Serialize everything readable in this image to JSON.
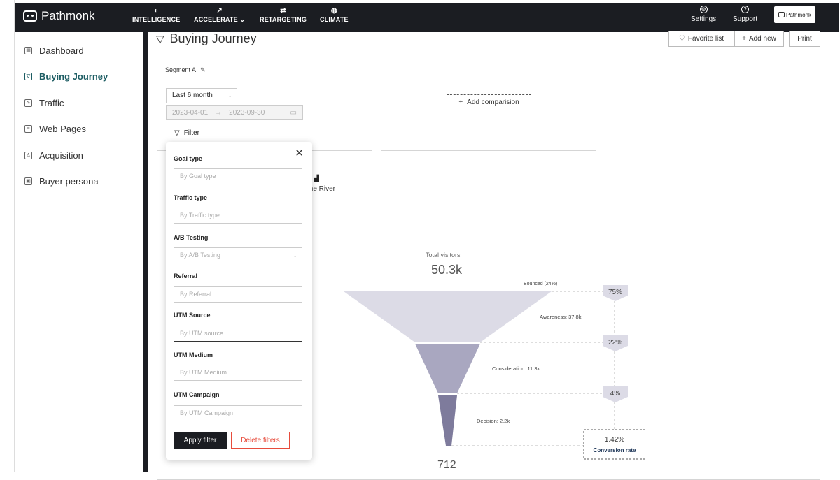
{
  "brand": "Pathmonk",
  "nav": [
    {
      "label": "INTELLIGENCE",
      "icon": "brain-icon"
    },
    {
      "label": "ACCELERATE",
      "icon": "trend-icon"
    },
    {
      "label": "RETARGETING",
      "icon": "retarget-icon"
    },
    {
      "label": "CLIMATE",
      "icon": "globe-icon"
    }
  ],
  "nav_right": [
    {
      "label": "Settings",
      "icon": "gear-icon"
    },
    {
      "label": "Support",
      "icon": "help-icon"
    }
  ],
  "account_label": "Pathmonk",
  "sidebar": [
    {
      "label": "Dashboard",
      "icon": "grid-icon",
      "active": false
    },
    {
      "label": "Buying Journey",
      "icon": "funnel-icon",
      "active": true
    },
    {
      "label": "Traffic",
      "icon": "chart-icon",
      "active": false
    },
    {
      "label": "Web Pages",
      "icon": "page-icon",
      "active": false
    },
    {
      "label": "Acquisition",
      "icon": "trophy-icon",
      "active": false
    },
    {
      "label": "Buyer persona",
      "icon": "persona-icon",
      "active": false
    }
  ],
  "page_title": "Buying Journey",
  "toolbar": {
    "favorite": "Favorite list",
    "add_new": "Add new",
    "print": "Print"
  },
  "segment": {
    "label": "Segment A",
    "period": "Last 6 month",
    "date_from": "2023-04-01",
    "date_to": "2023-09-30",
    "filter_label": "Filter"
  },
  "add_comparison": "Add comparision",
  "river_label": "me River",
  "funnel": {
    "total_label": "Total visitors",
    "total_value": "50.3k",
    "bounced": "Bounced (24%)",
    "stages": [
      "Awareness: 37.8k",
      "Consideration: 11.3k",
      "Decision: 2.2k"
    ],
    "percents": [
      "75%",
      "22%",
      "4%"
    ],
    "conversion_value": "1.42%",
    "conversion_label": "Conversion rate",
    "final_value": "712"
  },
  "filters": [
    {
      "label": "Goal type",
      "placeholder": "By Goal type",
      "dropdown": false
    },
    {
      "label": "Traffic type",
      "placeholder": "By Traffic type",
      "dropdown": false
    },
    {
      "label": "A/B Testing",
      "placeholder": "By A/B Testing",
      "dropdown": true
    },
    {
      "label": "Referral",
      "placeholder": "By Referral",
      "dropdown": false
    },
    {
      "label": "UTM Source",
      "placeholder": "By UTM source",
      "dropdown": false
    },
    {
      "label": "UTM Medium",
      "placeholder": "By UTM Medium",
      "dropdown": false
    },
    {
      "label": "UTM Campaign",
      "placeholder": "By UTM Campaign",
      "dropdown": false
    }
  ],
  "apply_label": "Apply filter",
  "delete_label": "Delete filters",
  "colors": {
    "topbar": "#1b1d22",
    "accent": "#1d5d63",
    "danger": "#e74c3c",
    "funnel_top": "#dcdbe6",
    "funnel_mid": "#a9a7c0",
    "funnel_low": "#7e7b9c"
  }
}
